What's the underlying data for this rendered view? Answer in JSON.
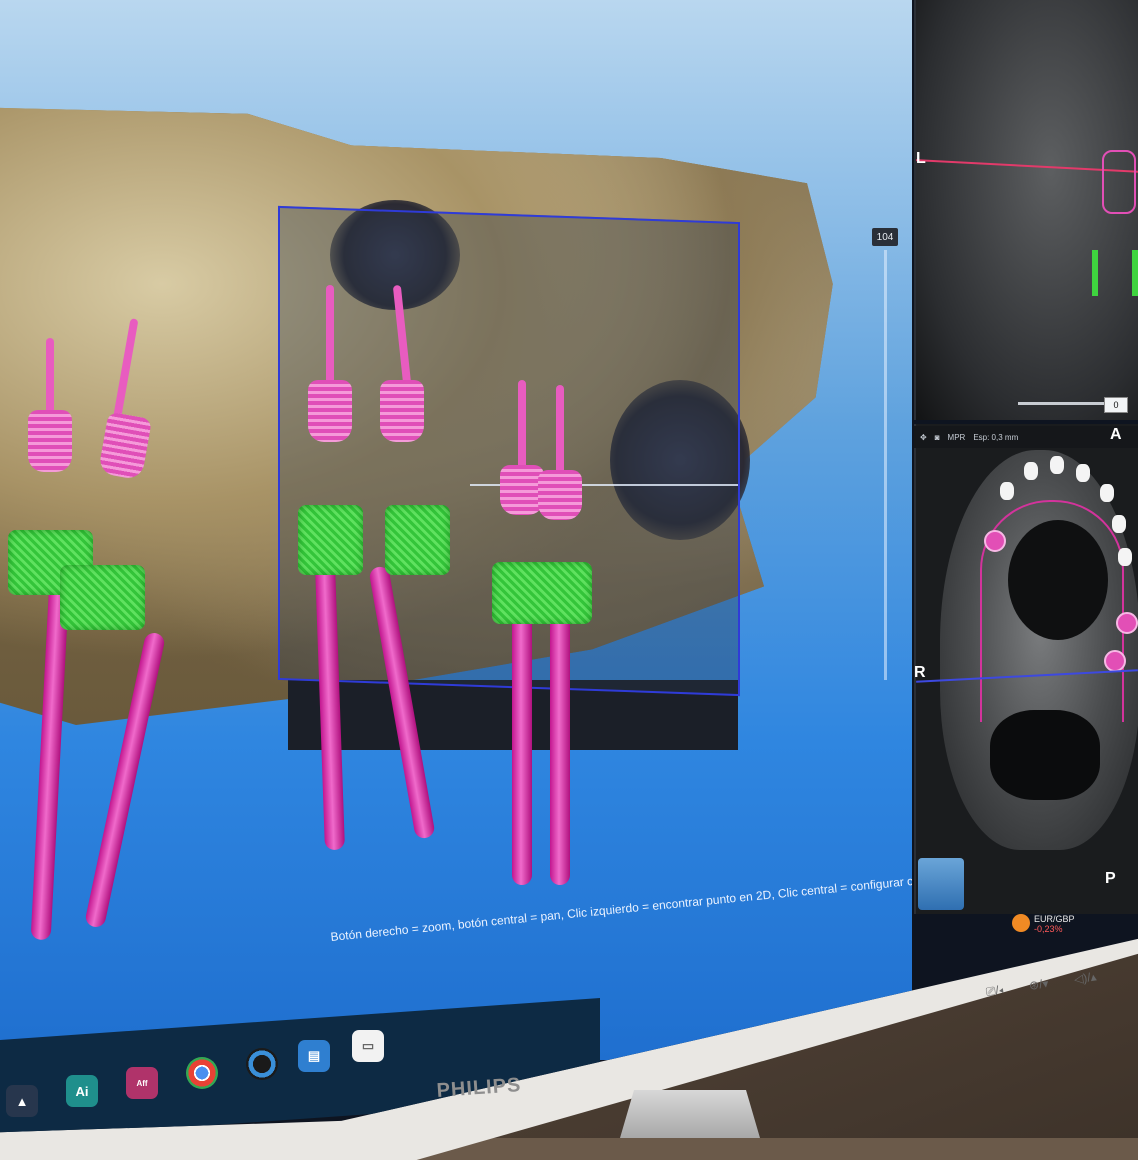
{
  "viewer3d": {
    "zoom_value": "104",
    "status_hint": "Botón derecho = zoom, botón central = pan, Clic izquierdo = encontrar punto en 2D, Clic central = configurar centro"
  },
  "coronal": {
    "label_left": "L",
    "slider_value": "0"
  },
  "axial": {
    "toolbar_mpr": "MPR",
    "toolbar_thickness": "Esp: 0,3 mm",
    "label_anterior": "A",
    "label_right": "R",
    "label_posterior": "P"
  },
  "ticker": {
    "pair": "EUR/GBP",
    "change": "-0,23%"
  },
  "taskbar": {
    "apps": [
      {
        "name": "Ai",
        "color": "#1f8f8c"
      },
      {
        "name": "Aff",
        "color": "#b0336a"
      },
      {
        "name": "chrome",
        "color": "#ffffff"
      },
      {
        "name": "app",
        "color": "#1a1a1a"
      },
      {
        "name": "app2",
        "color": "#2f7fd0"
      },
      {
        "name": "doc",
        "color": "#f2f2f2"
      }
    ]
  },
  "monitor": {
    "brand": "PHILIPS"
  },
  "colors": {
    "implant": "#e85cc0",
    "crown": "#3fd43f",
    "plane_border": "#2f3bd8",
    "viewport_bg": "#2f86e0"
  }
}
